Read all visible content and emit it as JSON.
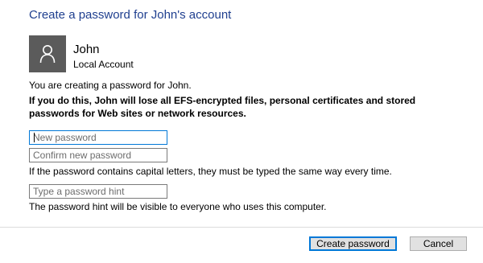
{
  "title": "Create a password for John's account",
  "account": {
    "name": "John",
    "type": "Local Account",
    "avatar_icon": "user-icon"
  },
  "intro_text": "You are creating a password for John.",
  "warning_text": "If you do this, John will lose all EFS-encrypted files, personal certificates and stored passwords for Web sites or network resources.",
  "fields": {
    "new_password": {
      "placeholder": "New password",
      "value": ""
    },
    "confirm_password": {
      "placeholder": "Confirm new password",
      "value": ""
    },
    "password_hint": {
      "placeholder": "Type a password hint",
      "value": ""
    }
  },
  "capital_letters_note": "If the password contains capital letters, they must be typed the same way every time.",
  "hint_note": "The password hint will be visible to everyone who uses this computer.",
  "buttons": {
    "create_label": "Create password",
    "cancel_label": "Cancel"
  },
  "colors": {
    "title": "#1f3f8f",
    "accent": "#0078d7",
    "avatar_bg": "#5b5b5b"
  }
}
